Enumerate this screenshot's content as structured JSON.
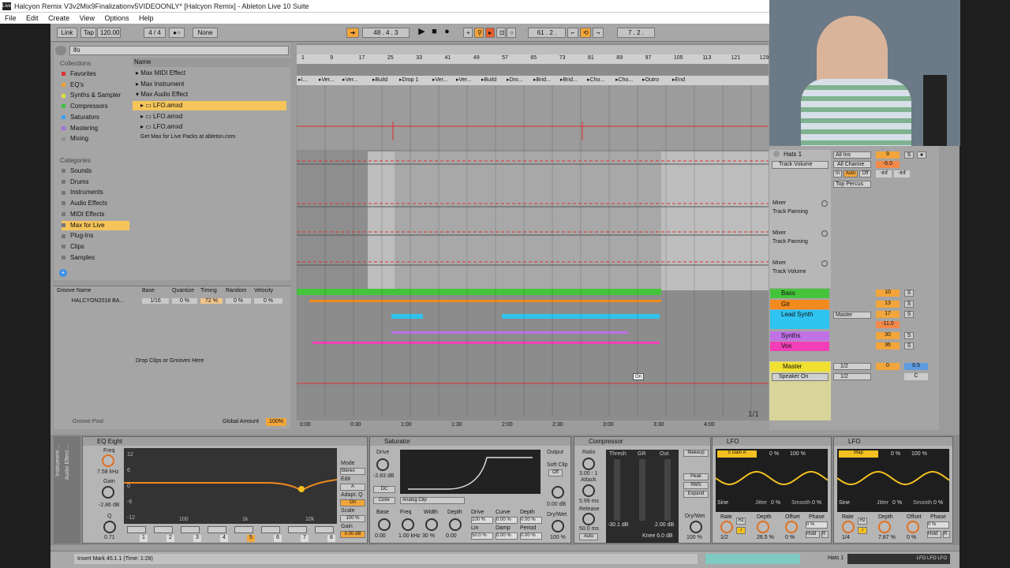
{
  "window": {
    "title": "Halcyon Remix V3v2Mix9Finalizationv5VIDEOONLY*  [Halcyon Remix] - Ableton Live 10 Suite"
  },
  "menu": [
    "File",
    "Edit",
    "Create",
    "View",
    "Options",
    "Help"
  ],
  "control_bar": {
    "link": "Link",
    "tap": "Tap",
    "tempo": "120.00",
    "sig": "4 / 4",
    "metro": "None",
    "position": "48 .   4 .   3",
    "loop_start": "61 .   2 .",
    "loop_len": "7 .   2 ."
  },
  "browser": {
    "search": "lfo",
    "collections_label": "Collections",
    "collections": [
      {
        "label": "Favorites",
        "color": "#e03030"
      },
      {
        "label": "EQ's",
        "color": "#f0a030"
      },
      {
        "label": "Synths & Sampler",
        "color": "#e0e040"
      },
      {
        "label": "Compressors",
        "color": "#40c040"
      },
      {
        "label": "Saturators",
        "color": "#40a0f0"
      },
      {
        "label": "Mastering",
        "color": "#a070e0"
      },
      {
        "label": "Mixing",
        "color": "#909090"
      }
    ],
    "categories_label": "Categories",
    "categories": [
      "Sounds",
      "Drums",
      "Instruments",
      "Audio Effects",
      "MIDI Effects",
      "Max for Live",
      "Plug-Ins",
      "Clips",
      "Samples"
    ],
    "name_header": "Name",
    "tree": [
      "Max MIDI Effect",
      "Max Instrument",
      "Max Audio Effect"
    ],
    "files": [
      "LFO.amxd",
      "LFO.amxd",
      "LFO.amxd",
      "LFO.amxd"
    ],
    "get_max": "Get Max for Live Packs at ableton.com"
  },
  "groove": {
    "headers": [
      "Groove Name",
      "Base",
      "Quantize",
      "Timing",
      "Random",
      "Velocity"
    ],
    "row": [
      "HALCYON2018 BA...",
      "1/16",
      "0 %",
      "72 %",
      "0 %",
      "0 %"
    ],
    "drop": "Drop Clips or Grooves Here",
    "pool": "Groove Pool",
    "global": "Global Amount",
    "global_val": "100%"
  },
  "arrangement": {
    "bars": [
      "1",
      "9",
      "17",
      "25",
      "33",
      "41",
      "49",
      "57",
      "65",
      "73",
      "81",
      "89",
      "97",
      "105",
      "113",
      "121",
      "129"
    ],
    "locators": [
      "I...",
      "Ver...",
      "Ver...",
      "Build",
      "Drop 1",
      "Ver...",
      "Ver...",
      "Build",
      "Dro...",
      "Brid...",
      "Brid...",
      "Cho...",
      "Cho...",
      "Outro",
      "End"
    ],
    "times": [
      "0:00",
      "0:30",
      "1:00",
      "1:30",
      "2:00",
      "2:30",
      "3:00",
      "3:30",
      "4:00"
    ],
    "page": "1/1",
    "on_tag": "On"
  },
  "mixer": {
    "hats": "Hats 1",
    "all_ins": "All Ins",
    "all_chan": "All Channe",
    "top_perc": "Top Percus",
    "in": "In",
    "auto": "Auto",
    "off": "Off",
    "vol_num": "9",
    "vol_db": "-6.0",
    "inf1": "-inf",
    "inf2": "-inf",
    "track_volume": "Track Volume",
    "auto_lanes": [
      {
        "dev": "Mixer",
        "param": "Track Panning"
      },
      {
        "dev": "Mixer",
        "param": "Track Panning"
      },
      {
        "dev": "Mixer",
        "param": "Track Volume"
      }
    ],
    "tracks": [
      {
        "name": "Bass",
        "color": "#45c43b",
        "num": "10"
      },
      {
        "name": "Gtr",
        "color": "#f28a1e",
        "num": "13"
      },
      {
        "name": "Lead Synth",
        "color": "#2ec3f0",
        "num": "17"
      },
      {
        "name": "Synths",
        "color": "#c071e6",
        "num": "30"
      },
      {
        "name": "Vox",
        "color": "#f23fb7",
        "num": "36"
      }
    ],
    "lead_out": "Master",
    "lead_db": "-11.0",
    "master": "Master",
    "speaker": "Speaker On",
    "half1": "1/2",
    "half2": "1/2",
    "master_num": "0",
    "master_db": "6.5"
  },
  "devices": {
    "eq": {
      "title": "EQ Eight",
      "freq": "7.58 kHz",
      "gain": "-2.86 dB",
      "q": "0.71",
      "mode": "Mode",
      "mode_val": "Stereo",
      "edit": "Edit",
      "edit_val": "A",
      "adapt": "Adapt. Q",
      "adapt_val": "On",
      "scale": "Scale",
      "scale_val": "100 %",
      "out": "Gain",
      "out_val": "0.00 dB",
      "bands": [
        "1",
        "2",
        "3",
        "4",
        "5",
        "6",
        "7",
        "8"
      ],
      "freqs": [
        "100",
        "1k",
        "10k"
      ],
      "gains": [
        "12",
        "6",
        "0",
        "-6",
        "-12"
      ]
    },
    "sat": {
      "title": "Saturator",
      "drive": "Drive",
      "drive_val": "-2.83 dB",
      "dc": "DC",
      "color": "Color",
      "type": "Analog Clip",
      "output": "Output",
      "soft": "Soft Clip",
      "soft_val": "Off",
      "out_val": "0.00 dB",
      "drywet": "Dry/Wet",
      "dw_val": "100 %",
      "base": "Base",
      "freq": "Freq",
      "width": "Width",
      "depth": "Depth",
      "b_val": "0.00",
      "f_val": "1.00 kHz",
      "w_val": "30 %",
      "d_val": "0.00",
      "drive2": "Drive",
      "curve": "Curve",
      "depth2": "Depth",
      "lin": "Lin",
      "damp": "Damp",
      "period": "Period",
      "drive2_val": "100 %",
      "curve_val": "0.00 %",
      "depth2_val": "0.00 %",
      "lin_val": "50.0 %",
      "damp_val": "0.00 %",
      "period_val": "0.00 %"
    },
    "comp": {
      "title": "Compressor",
      "ratio": "Ratio",
      "ratio_val": "3.00 : 1",
      "attack": "Attack",
      "attack_val": "5.99 ms",
      "release": "Release",
      "release_val": "50.0 ms",
      "auto": "Auto",
      "thresh": "Thresh",
      "gr": "GR",
      "out": "Out",
      "thresh_val": "-30.1 dB",
      "out_val": "2.00 dB",
      "knee": "Knee 6.0 dB",
      "makeup": "Makeup",
      "peak": "Peak",
      "rms": "RMS",
      "expand": "Expand",
      "drywet": "Dry/Wet",
      "dw_val": "100 %"
    },
    "lfo1": {
      "title": "LFO",
      "map": "5 Gain A",
      "depth_pct": "0 %",
      "amt": "100 %",
      "shape": "Sine",
      "jitter": "Jitter",
      "jitter_val": "0 %",
      "smooth": "Smooth",
      "smooth_val": "0 %",
      "rate": "Rate",
      "depth": "Depth",
      "offset": "Offset",
      "phase": "Phase",
      "rate_val": "1/2",
      "depth_val": "26.5 %",
      "offset_val": "0 %",
      "phase_val": "0 %",
      "hz": "Hz",
      "hold": "Hold",
      "r": "R"
    },
    "lfo2": {
      "title": "LFO",
      "map": "Map",
      "depth_pct": "0 %",
      "amt": "100 %",
      "shape": "Sine",
      "jitter": "Jitter",
      "jitter_val": "0 %",
      "smooth": "Smooth",
      "smooth_val": "0 %",
      "rate": "Rate",
      "depth": "Depth",
      "offset": "Offset",
      "phase": "Phase",
      "rate_val": "1/4",
      "depth_val": "7.87 %",
      "offset_val": "0 %",
      "phase_val": "0 %",
      "hz": "Hz",
      "hold": "Hold",
      "r": "R"
    },
    "rack_labels": [
      "Instrument ...",
      "Audio Effect ..."
    ]
  },
  "status": {
    "text": "Insert Mark 45.1.1 (Time: 1:28)",
    "track": "Hats 1",
    "lfo": "LFO LFO LFO"
  }
}
